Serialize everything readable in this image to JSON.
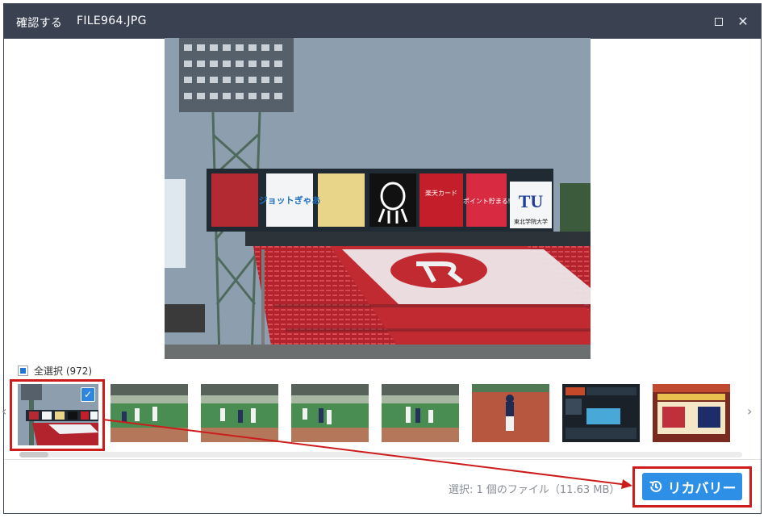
{
  "titlebar": {
    "title": "確認する",
    "filename": "FILE964.JPG",
    "maximize_icon": "maximize-icon",
    "close_icon": "close-icon",
    "close_glyph": "✕"
  },
  "preview": {
    "banners": [
      "ジョットぎゃあ",
      "楽天カード",
      "ポイント貯まる!",
      "TU",
      "東北学院大学"
    ]
  },
  "gallery": {
    "select_all_label": "全選択 (972)",
    "left_arrow": "‹",
    "right_arrow": "›",
    "thumbnails": [
      {
        "name": "stadium",
        "selected": true
      },
      {
        "name": "baseball-field-1",
        "selected": false
      },
      {
        "name": "baseball-field-2",
        "selected": false
      },
      {
        "name": "baseball-field-3",
        "selected": false
      },
      {
        "name": "baseball-field-4",
        "selected": false
      },
      {
        "name": "pitcher",
        "selected": false
      },
      {
        "name": "scoreboard",
        "selected": false
      },
      {
        "name": "todays-matchup",
        "selected": false
      }
    ],
    "check_glyph": "✓"
  },
  "footer": {
    "status": "選択: 1 個のファイル（11.63 MB）",
    "recover_label": "リカバリー",
    "recover_icon": "history-icon"
  },
  "colors": {
    "titlebar": "#3a4252",
    "accent": "#2e8fe6",
    "highlight": "#cc1c1c"
  }
}
